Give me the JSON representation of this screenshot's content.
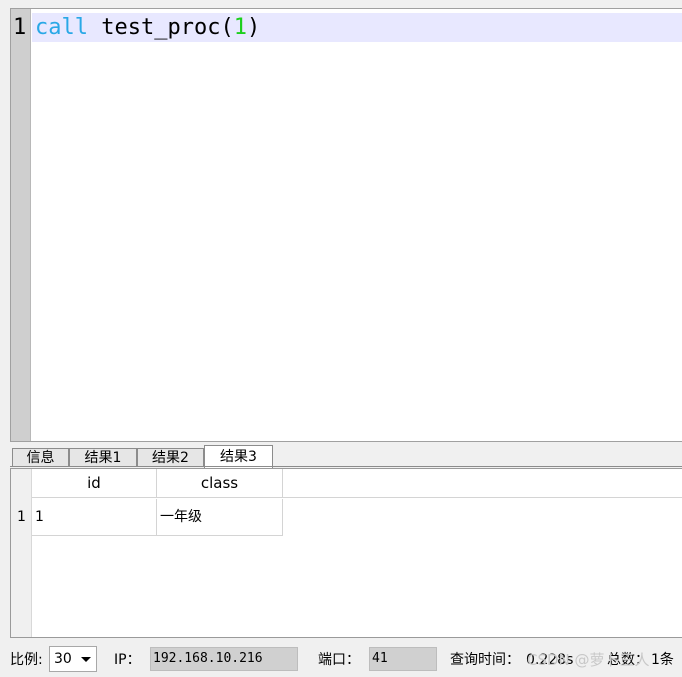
{
  "editor": {
    "line_number": "1",
    "code": {
      "keyword": "call",
      "space": " ",
      "name": "test_proc(",
      "arg": "1",
      "close": ")"
    }
  },
  "tabs": [
    {
      "label": "信息"
    },
    {
      "label": "结果1"
    },
    {
      "label": "结果2"
    },
    {
      "label": "结果3",
      "active": true
    }
  ],
  "grid": {
    "columns": [
      "id",
      "class"
    ],
    "rows": [
      {
        "row_number": "1",
        "cells": [
          "1",
          "一年级"
        ]
      }
    ]
  },
  "status": {
    "scale_label": "比例:",
    "scale_value": "30",
    "ip_label": "IP：",
    "ip_value": "192.168.10.216",
    "port_label": "端口：",
    "port_value": "41",
    "query_time_label": "查询时间：",
    "query_time_value": "0.228s",
    "total_label": "总数：",
    "total_value": "1条",
    "watermark": "CSDN @萝卜三人"
  },
  "colors": {
    "keyword": "#29a8e6",
    "number": "#1ccf1c",
    "current_line": "#e8e8ff"
  }
}
